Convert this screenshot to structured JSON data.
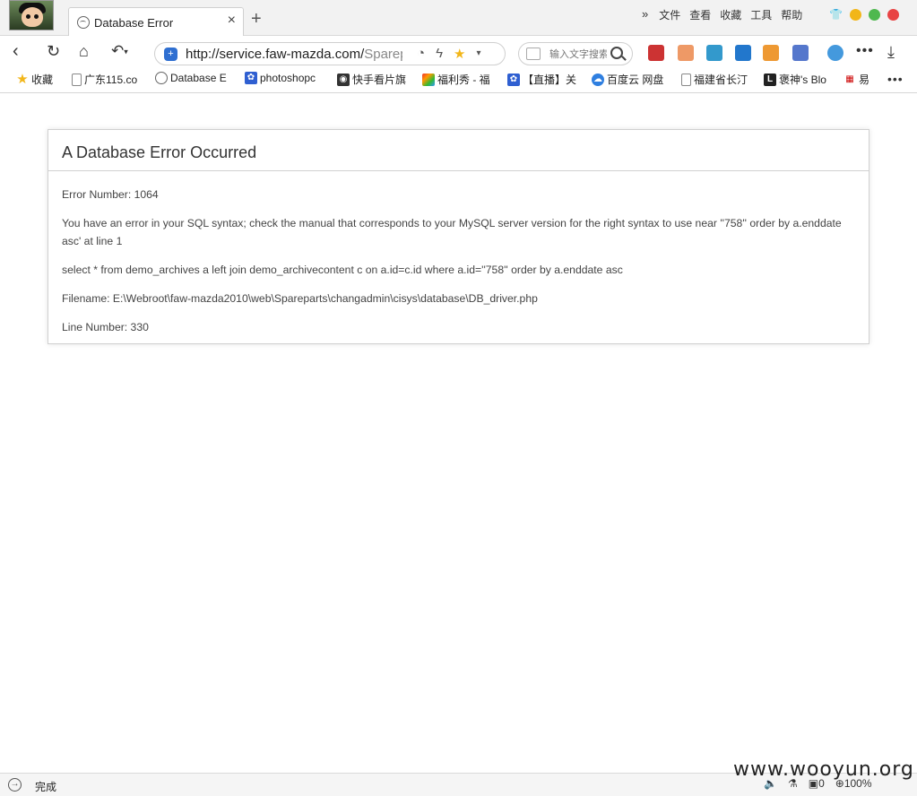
{
  "tab": {
    "title": "Database Error",
    "close": "×",
    "new_tab": "+"
  },
  "menu": {
    "chevron": "»",
    "items": [
      "文件",
      "查看",
      "收藏",
      "工具",
      "帮助"
    ]
  },
  "window_dots": {
    "colors": [
      "#f2b619",
      "#4fb84f",
      "#e84444"
    ]
  },
  "nav": {
    "url_host": "http://service.faw-mazda.com/",
    "url_path": "Sparepa",
    "search_placeholder": "输入文字搜索"
  },
  "bookmarks": [
    {
      "label": "收藏",
      "icon": "star-icon"
    },
    {
      "label": "广东115.co",
      "icon": "page-icon"
    },
    {
      "label": "Database E",
      "icon": "mazda-logo-icon"
    },
    {
      "label": "photoshopc",
      "icon": "paw-icon"
    },
    {
      "label": "快手看片旗",
      "icon": "camera-icon"
    },
    {
      "label": "福利秀 - 福",
      "icon": "multicolor-icon"
    },
    {
      "label": "【直播】关",
      "icon": "paw-icon"
    },
    {
      "label": "百度云 网盘",
      "icon": "baidu-cloud-icon"
    },
    {
      "label": "福建省长汀",
      "icon": "page-icon"
    },
    {
      "label": "褒神's Blo",
      "icon": "L-icon"
    },
    {
      "label": "易",
      "icon": "logo-icon"
    }
  ],
  "error": {
    "heading": "A Database Error Occurred",
    "error_number": "Error Number: 1064",
    "message": "You have an error in your SQL syntax; check the manual that corresponds to your MySQL server version for the right syntax to use near ''758'' order by a.enddate asc' at line 1",
    "query": "select * from demo_archives a left join demo_archivecontent c on a.id=c.id where a.id=''758'' order by a.enddate asc",
    "filename": "Filename: E:\\Webroot\\faw-mazda2010\\web\\Spareparts\\changadmin\\cisys\\database\\DB_driver.php",
    "line_number": "Line Number: 330"
  },
  "status": {
    "text": "完成",
    "count": "0",
    "zoom": "100%"
  },
  "watermark": "www.wooyun.org"
}
